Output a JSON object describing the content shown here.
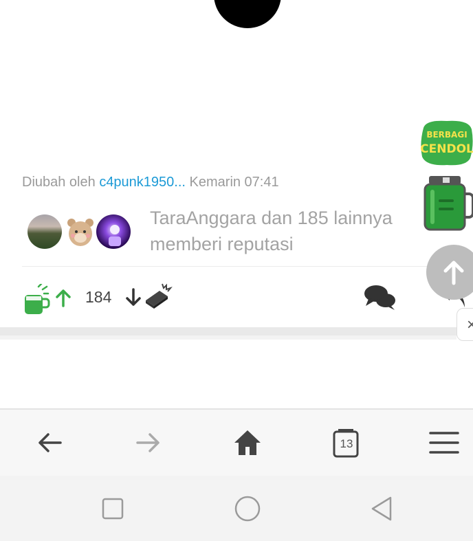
{
  "post": {
    "edited_prefix": "Diubah oleh",
    "edited_user": "c4punk1950...",
    "edited_time": "Kemarin 07:41",
    "reputation_text": "TaraAnggara dan 185 lainnya memberi reputasi",
    "vote_count": "184"
  },
  "floating": {
    "sticker_text_line1": "BERBAGI",
    "sticker_text_line2": "CENDOL",
    "close_symbol": "×"
  },
  "browser": {
    "tabs_count": "13",
    "buttons": [
      "back-arrow-icon",
      "forward-arrow-icon",
      "home-icon",
      "tabs-icon",
      "menu-icon"
    ]
  },
  "colors": {
    "link_blue": "#1c9ad6",
    "cendol_green": "#3cae4a",
    "muted_text": "#a3a3a3"
  }
}
